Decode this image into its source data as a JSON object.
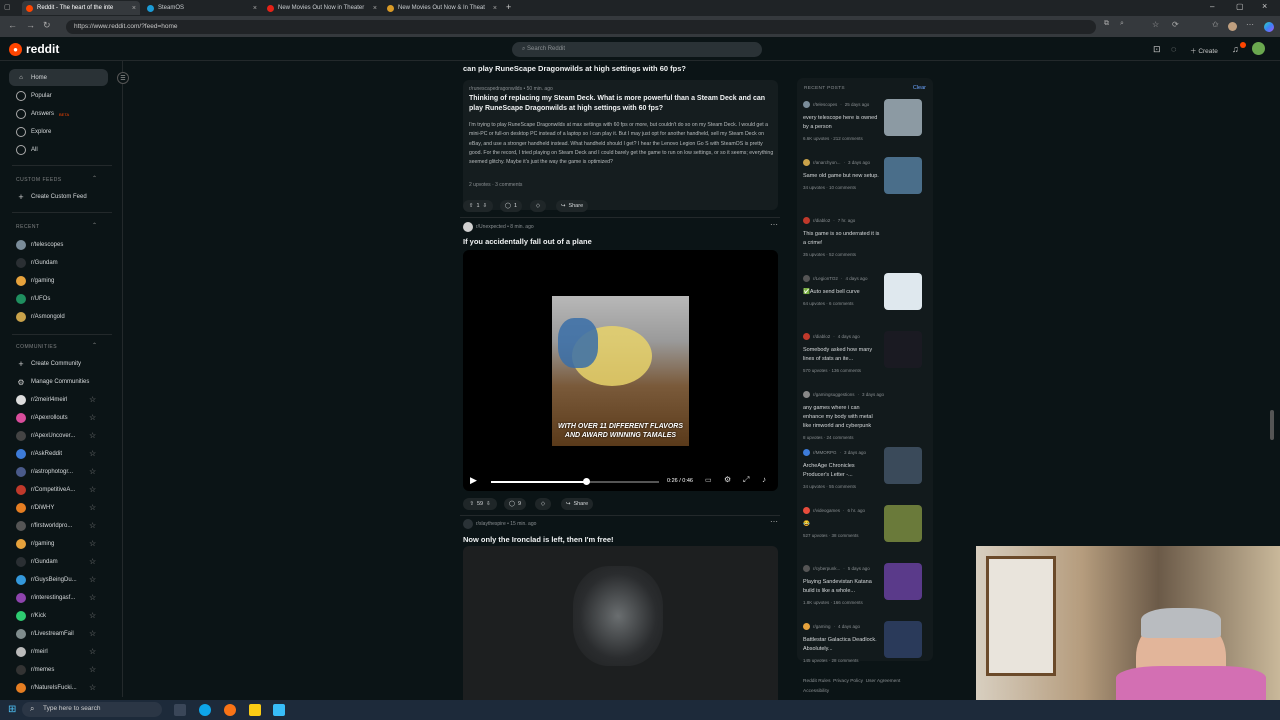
{
  "browser": {
    "tabs": [
      {
        "label": "Reddit - The heart of the inte",
        "favicon_color": "#ff4500"
      },
      {
        "label": "SteamOS",
        "favicon_color": "#1b9bd6"
      },
      {
        "label": "New Movies Out Now in Theater",
        "favicon_color": "#e62117"
      },
      {
        "label": "New Movies Out Now & In Theat",
        "favicon_color": "#d99a26"
      }
    ],
    "new_tab": "+",
    "url": "https://www.reddit.com/?feed=home"
  },
  "header": {
    "logo": "reddit",
    "search_placeholder": "Search Reddit",
    "create_label": "Create"
  },
  "sidebar": {
    "nav": [
      {
        "label": "Home",
        "icon": "home-icon"
      },
      {
        "label": "Popular",
        "icon": "popular-icon"
      },
      {
        "label": "Answers",
        "icon": "answers-icon",
        "badge": "BETA"
      },
      {
        "label": "Explore",
        "icon": "explore-icon"
      },
      {
        "label": "All",
        "icon": "all-icon"
      }
    ],
    "custom_feeds_heading": "CUSTOM FEEDS",
    "create_custom_feed": "Create Custom Feed",
    "recent_heading": "RECENT",
    "recent": [
      {
        "label": "r/telescopes",
        "color": "#7a8c99"
      },
      {
        "label": "r/Gundam",
        "color": "#2a2f33"
      },
      {
        "label": "r/gaming",
        "color": "#e6a23c"
      },
      {
        "label": "r/UFOs",
        "color": "#1f8f5f"
      },
      {
        "label": "r/Asmongold",
        "color": "#c9a24a"
      }
    ],
    "communities_heading": "COMMUNITIES",
    "create_community": "Create Community",
    "manage_communities": "Manage Communities",
    "communities": [
      {
        "label": "r/2meirl4meirl",
        "color": "#dddddd"
      },
      {
        "label": "r/Apexrollouts",
        "color": "#d94d9b"
      },
      {
        "label": "r/ApexUncover...",
        "color": "#444444"
      },
      {
        "label": "r/AskReddit",
        "color": "#3d7bd9"
      },
      {
        "label": "r/astrophotogr...",
        "color": "#4a5a8a"
      },
      {
        "label": "r/CompetitiveA...",
        "color": "#c0392b"
      },
      {
        "label": "r/DiWHY",
        "color": "#e67e22"
      },
      {
        "label": "r/firstworldpro...",
        "color": "#555555"
      },
      {
        "label": "r/gaming",
        "color": "#e6a23c"
      },
      {
        "label": "r/Gundam",
        "color": "#2a2f33"
      },
      {
        "label": "r/GuysBeingDu...",
        "color": "#3498db"
      },
      {
        "label": "r/interestingasf...",
        "color": "#8e44ad"
      },
      {
        "label": "r/Kick",
        "color": "#2ecc71"
      },
      {
        "label": "r/LivestreamFail",
        "color": "#7f8c8d"
      },
      {
        "label": "r/meirl",
        "color": "#bbbbbb"
      },
      {
        "label": "r/memes",
        "color": "#333333"
      },
      {
        "label": "r/NatureIsFucki...",
        "color": "#e67e22"
      }
    ]
  },
  "feed": {
    "prev_post_title_tail": "can play RuneScape Dragonwilds at high settings with 60 fps?",
    "post1": {
      "subreddit": "r/runescapedragonwilds",
      "time": "50 min. ago",
      "title": "Thinking of replacing my Steam Deck. What is more powerful than a Steam Deck and can play RuneScape Dragonwilds at high settings with 60 fps?",
      "body": "I'm trying to play RuneScape Dragonwilds at max settings with 60 fps or more, but couldn't do so on my Steam Deck. I would get a mini-PC or full-on desktop PC instead of a laptop so I can play it. But I may just opt for another handheld, sell my Steam Deck on eBay, and use a stronger handheld instead. What handheld should I get? I hear the Lenovo Legion Go S with SteamOS is pretty good. For the record, I tried playing on Steam Deck and I could barely get the game to run on low settings, or so it seems; everything seemed glitchy. Maybe it's just the way the game is optimized?",
      "upvotes_label": "2 upvotes",
      "comments_label": "3 comments",
      "score": "1",
      "comments": "1",
      "share": "Share"
    },
    "post2": {
      "subreddit": "r/Unexpected",
      "time": "8 min. ago",
      "title": "If you accidentally fall out of a plane",
      "caption": "WITH OVER 11 DIFFERENT FLAVORS AND AWARD WINNING TAMALES",
      "time_display": "0:26 / 0:46",
      "progress": 0.57,
      "score": "59",
      "comments": "9",
      "share": "Share"
    },
    "post3": {
      "subreddit": "r/slaythespire",
      "time": "15 min. ago",
      "title": "Now only the Ironclad is left, then I'm free!"
    }
  },
  "recent_posts": {
    "heading": "RECENT POSTS",
    "clear": "Clear",
    "items": [
      {
        "sub": "r/telescopes",
        "time": "25 days ago",
        "title": "every telescope here is owned by a person",
        "stats": "6.6K upvotes · 212 comments",
        "thumb": "#8c9aa3",
        "av": "#7a8c99"
      },
      {
        "sub": "r/anarchyon...",
        "time": "3 days ago",
        "title": "Same old game but new setup.",
        "stats": "34 upvotes · 10 comments",
        "thumb": "#4a6e8a",
        "av": "#c9a24a"
      },
      {
        "sub": "r/diablo2",
        "time": "7 hr. ago",
        "title": "This game is so underrated it is a crime!",
        "stats": "35 upvotes · 52 comments",
        "thumb": "",
        "av": "#c0392b"
      },
      {
        "sub": "r/LegionTO2",
        "time": "4 days ago",
        "title": "✅Auto send bell curve",
        "stats": "64 upvotes · 6 comments",
        "thumb": "#dfe8ee",
        "av": "#555555"
      },
      {
        "sub": "r/diablo2",
        "time": "4 days ago",
        "title": "Somebody asked how many lines of stats an ite...",
        "stats": "570 upvotes · 136 comments",
        "thumb": "#1a1a22",
        "av": "#c0392b"
      },
      {
        "sub": "r/gamingsuggestions",
        "time": "3 days ago",
        "title": "any games where i can enhance my body with metal like rimworld and cyberpunk",
        "stats": "8 upvotes · 24 comments",
        "thumb": "",
        "av": "#888888"
      },
      {
        "sub": "r/MMORPG",
        "time": "3 days ago",
        "title": "ArcheAge Chronicles Producer's Letter -...",
        "stats": "34 upvotes · 55 comments",
        "thumb": "#3a4a5a",
        "av": "#3d7bd9"
      },
      {
        "sub": "r/videogames",
        "time": "6 hr. ago",
        "title": "😂",
        "stats": "527 upvotes · 38 comments",
        "thumb": "#6a7a3a",
        "av": "#e74c3c"
      },
      {
        "sub": "r/cyberpunk...",
        "time": "5 days ago",
        "title": "Playing Sandevistan Katana build is like a whole...",
        "stats": "1.8K upvotes · 166 comments",
        "thumb": "#5a3a8a",
        "av": "#555555"
      },
      {
        "sub": "r/gaming",
        "time": "4 days ago",
        "title": "Battlestar Galactica Deadlock. Absolutely...",
        "stats": "145 upvotes · 28 comments",
        "thumb": "#2a3a5a",
        "av": "#e6a23c"
      }
    ],
    "footer": [
      "Reddit Rules",
      "Privacy Policy",
      "User Agreement",
      "Accessibility"
    ]
  },
  "taskbar": {
    "search_placeholder": "Type here to search"
  }
}
